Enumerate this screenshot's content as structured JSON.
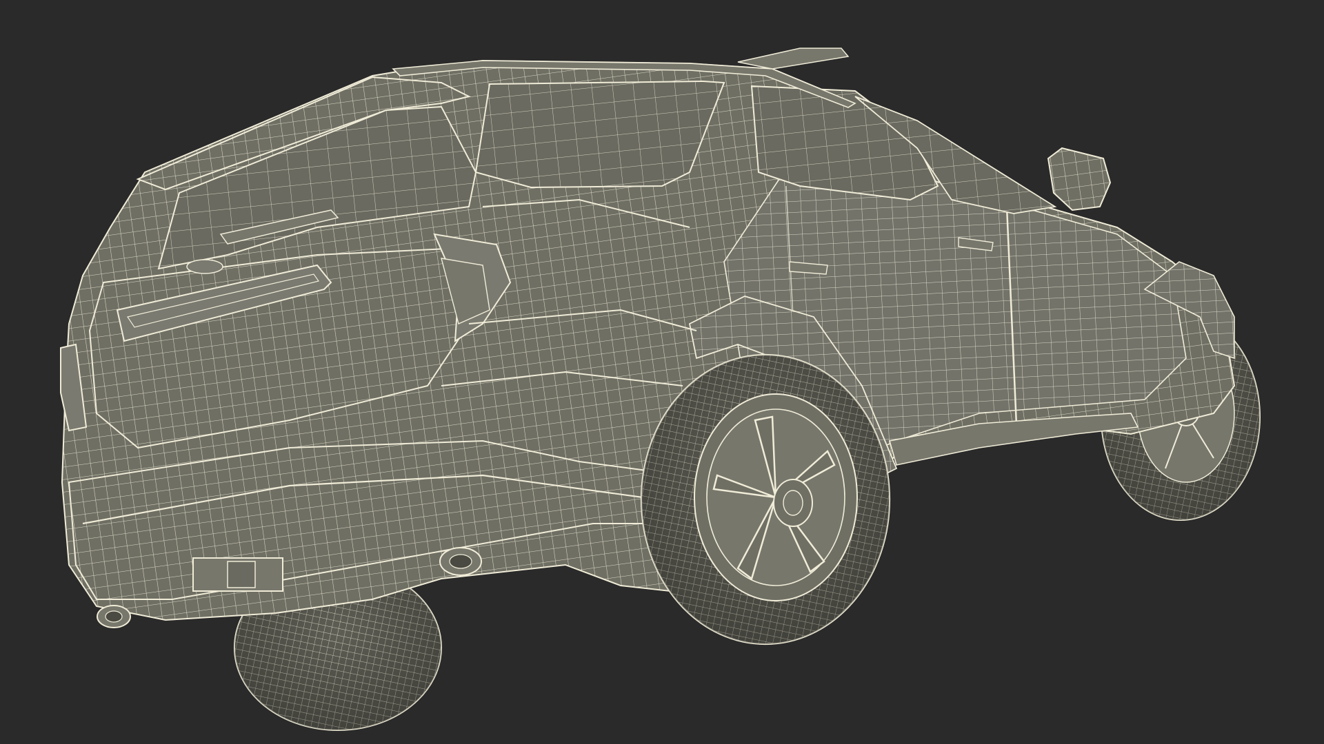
{
  "viewport": {
    "background_color": "#2a2a2a"
  },
  "model": {
    "subject": "suv-wireframe",
    "surface_color": "#6f6f64",
    "surface_shadow_color": "#4a4a42",
    "wire_color": "#f0ecd8",
    "tire_color": "#5e5e55",
    "rim_color": "#77776c"
  }
}
